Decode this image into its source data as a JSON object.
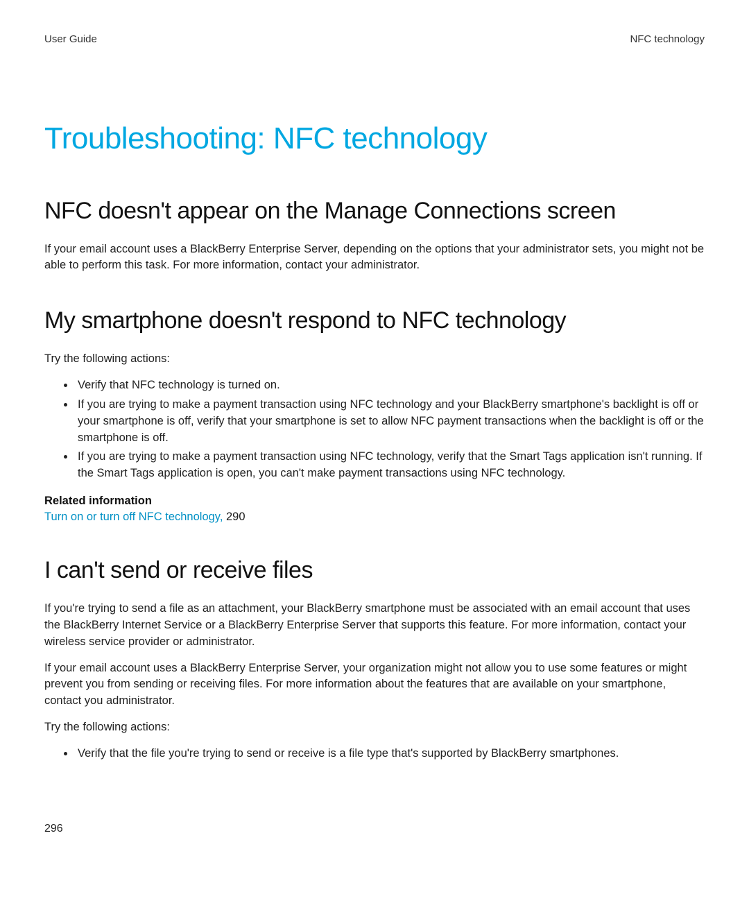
{
  "header": {
    "left": "User Guide",
    "right": "NFC technology"
  },
  "title": "Troubleshooting: NFC technology",
  "sections": [
    {
      "heading": "NFC doesn't appear on the Manage Connections screen",
      "paragraphs": [
        "If your email account uses a BlackBerry Enterprise Server, depending on the options that your administrator sets, you might not be able to perform this task. For more information, contact your administrator."
      ]
    },
    {
      "heading": "My smartphone doesn't respond to NFC technology",
      "intro": "Try the following actions:",
      "bullets": [
        "Verify that NFC technology is turned on.",
        "If you are trying to make a payment transaction using NFC technology and your BlackBerry smartphone's backlight is off or your smartphone is off, verify that your smartphone is set to allow NFC payment transactions when the backlight is off or the smartphone is off.",
        "If you are trying to make a payment transaction using NFC technology, verify that the Smart Tags application isn't running. If the Smart Tags application is open, you can't make payment transactions using NFC technology."
      ],
      "related": {
        "heading": "Related information",
        "link_text": "Turn on or turn off NFC technology, ",
        "page_ref": "290"
      }
    },
    {
      "heading": "I can't send or receive files",
      "paragraphs": [
        "If you're trying to send a file as an attachment, your BlackBerry smartphone must be associated with an email account that uses the BlackBerry Internet Service or a BlackBerry Enterprise Server that supports this feature. For more information, contact your wireless service provider or administrator.",
        "If your email account uses a BlackBerry Enterprise Server, your organization might not allow you to use some features or might prevent you from sending or receiving files. For more information about the features that are available on your smartphone, contact you administrator.",
        "Try the following actions:"
      ],
      "bullets": [
        "Verify that the file you're trying to send or receive is a file type that's supported by BlackBerry smartphones."
      ]
    }
  ],
  "page_number": "296"
}
